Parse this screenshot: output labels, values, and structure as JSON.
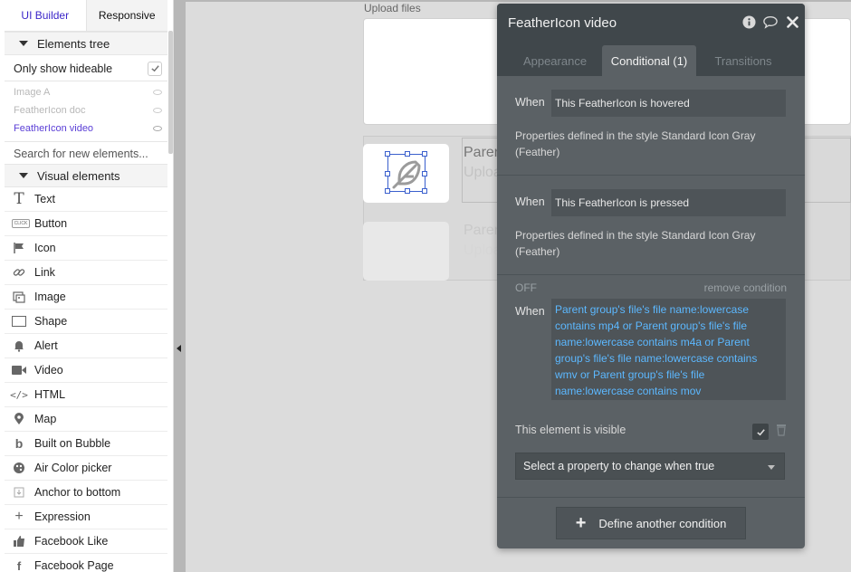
{
  "sidebar": {
    "tabs": [
      {
        "label": "UI Builder"
      },
      {
        "label": "Responsive"
      }
    ],
    "elements_tree": {
      "title": "Elements tree",
      "only_show_hideable": "Only show hideable",
      "items": [
        {
          "label": "Image A"
        },
        {
          "label": "FeatherIcon doc"
        },
        {
          "label": "FeatherIcon video"
        }
      ],
      "search_placeholder": "Search for new elements..."
    },
    "visual_elements": {
      "title": "Visual elements",
      "items": [
        {
          "label": "Text",
          "icon": "text-icon"
        },
        {
          "label": "Button",
          "icon": "button-icon",
          "icon_text": "CLICK"
        },
        {
          "label": "Icon",
          "icon": "flag-icon"
        },
        {
          "label": "Link",
          "icon": "link-icon"
        },
        {
          "label": "Image",
          "icon": "image-icon"
        },
        {
          "label": "Shape",
          "icon": "shape-icon"
        },
        {
          "label": "Alert",
          "icon": "bell-icon"
        },
        {
          "label": "Video",
          "icon": "video-icon"
        },
        {
          "label": "HTML",
          "icon": "code-icon"
        },
        {
          "label": "Map",
          "icon": "map-pin-icon"
        },
        {
          "label": "Built on Bubble",
          "icon": "bubble-icon"
        },
        {
          "label": "Air Color picker",
          "icon": "palette-icon"
        },
        {
          "label": "Anchor to bottom",
          "icon": "anchor-icon"
        },
        {
          "label": "Expression",
          "icon": "plus-icon"
        },
        {
          "label": "Facebook Like",
          "icon": "thumbs-up-icon"
        },
        {
          "label": "Facebook Page",
          "icon": "facebook-icon"
        }
      ]
    }
  },
  "canvas": {
    "upload_label": "Upload files",
    "row_title": "Parent",
    "row_subtitle": "Uploa"
  },
  "panel": {
    "title": "FeatherIcon video",
    "tabs": [
      {
        "label": "Appearance"
      },
      {
        "label": "Conditional (1)"
      },
      {
        "label": "Transitions"
      }
    ],
    "conditions": [
      {
        "when_label": "When",
        "when_value": "This FeatherIcon is hovered",
        "properties_text": "Properties defined in the style Standard Icon Gray (Feather)"
      },
      {
        "when_label": "When",
        "when_value": "This FeatherIcon is pressed",
        "properties_text": "Properties defined in the style Standard Icon Gray (Feather)"
      }
    ],
    "custom_condition": {
      "status": "OFF",
      "remove_label": "remove condition",
      "when_label": "When",
      "expression": "Parent group's file's file name:lowercase contains mp4 or Parent group's file's file name:lowercase contains m4a or Parent group's file's file name:lowercase contains wmv or Parent group's file's file name:lowercase contains mov",
      "visible_label": "This element is visible",
      "visible_checked": true,
      "select_placeholder": "Select a property to change when true"
    },
    "define_button": "Define another condition"
  }
}
